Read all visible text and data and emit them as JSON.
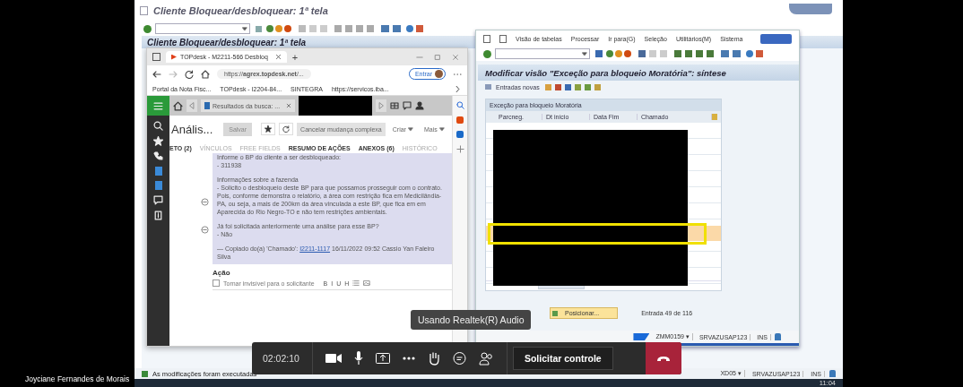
{
  "participant_name": "Joyciane Fernandes de Morais",
  "sap_main": {
    "title": "Cliente Bloquear/desbloquear: 1ª tela",
    "header": "Cliente Bloquear/desbloquear: 1ª tela",
    "status_message": "As modificações foram executadas",
    "status_bar": [
      "XD05 ▾",
      "SRVAZUSAP123",
      "INS"
    ]
  },
  "taskbar": {
    "time": "11:04"
  },
  "browser": {
    "tab_title": "TOPdesk - M2211-566 Desbloq",
    "new_tab": "+",
    "url": "https://**agrex.topdesk.net**/...",
    "signin": "Entrar",
    "bookmarks": [
      "Portal da Nota Fisc...",
      "TOPdesk - I2204-84...",
      "SINTEGRA",
      "https://servicos.iba..."
    ]
  },
  "topdesk": {
    "tabs": [
      {
        "label": "Resultados da busca: ...",
        "selected": false
      }
    ],
    "title": "Anális...",
    "buttons": [
      {
        "label": "Salvar",
        "disabled": true
      },
      {
        "label": "Cancelar mudança complexa",
        "disabled": false
      },
      {
        "label": "Criar",
        "disabled": false
      },
      {
        "label": "Mais",
        "disabled": false
      }
    ],
    "section_tabs": [
      {
        "label": "ETO (2)",
        "disabled": false
      },
      {
        "label": "VÍNCULOS",
        "disabled": true
      },
      {
        "label": "FREE FIELDS",
        "disabled": true
      },
      {
        "label": "RESUMO DE AÇÕES",
        "disabled": false
      },
      {
        "label": "ANEXOS (6)",
        "disabled": false
      },
      {
        "label": "HISTÓRICO",
        "disabled": true
      }
    ],
    "note": {
      "paragraphs": [
        [
          "Informe o BP do cliente a ser desbloqueado:",
          "- 311938"
        ],
        [
          "Informações sobre a fazenda",
          "- Solicito o desbloqueio deste BP para que possamos prosseguir com o contrato. Pois, conforme demonstra o relatório, a área com restrição fica em Medicilândia-PA, ou seja, a mais de 200km da área vinculada a este BP, que fica em em Aparecida do Rio Negro-TO e não tem restrições ambientais."
        ],
        [
          "Já foi solicitada anteriormente uma análise para esse BP?",
          "- Não"
        ]
      ],
      "copied": {
        "prefix": "— Copiado do(a) 'Chamado':",
        "link": "I2211-1117",
        "suffix": "16/11/2022 09:52 Cassio Yan Faleiro Silva"
      }
    },
    "action": {
      "label": "Ação",
      "checkbox": {
        "label": "Tornar invisível para o solicitante",
        "checked": false
      },
      "format_tools": [
        "B",
        "I",
        "U",
        "H"
      ]
    }
  },
  "sap_window": {
    "menu": [
      "Visão de tabelas",
      "Processar",
      "Ir para(G)",
      "Seleção",
      "Utilitários(M)",
      "Sistema"
    ],
    "header": "Modificar visão \"Exceção para bloqueio Moratória\": síntese",
    "new_entries": "Entradas novas",
    "table": {
      "title": "Exceção para bloqueio Moratória",
      "columns": [
        "Parcneg.",
        "Dt início",
        "Data Fim",
        "Chamado"
      ]
    },
    "position_button": "Posicionar...",
    "entry_info": "Entrada 49 de 116",
    "status_bar": [
      "ZMM0159 ▾",
      "SRVAZUSAP123",
      "INS"
    ]
  },
  "call": {
    "duration": "02:02:10",
    "tooltip": "Usando Realtek(R) Audio",
    "request_control": "Solicitar controle"
  }
}
